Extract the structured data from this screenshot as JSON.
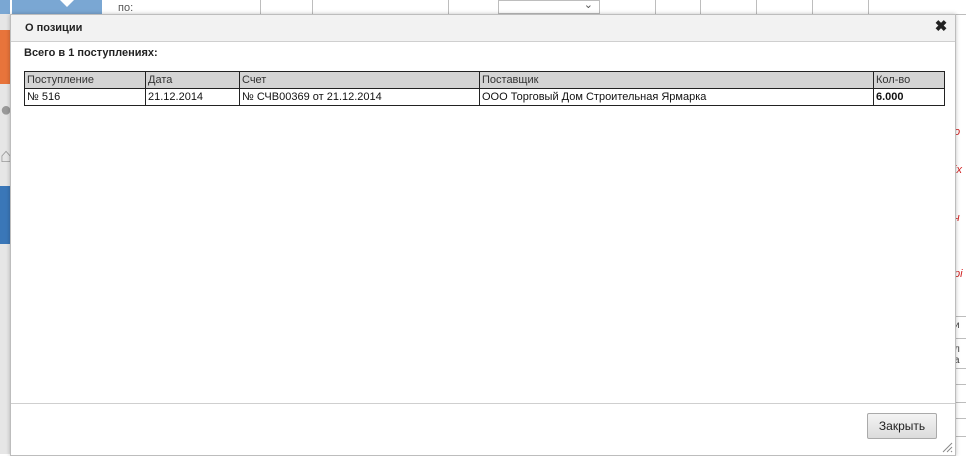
{
  "background": {
    "grid_header_text": "по:",
    "right_edge_red_fragments": [
      "о",
      "іх",
      "ч",
      "рі"
    ],
    "right_edge_gray_fragments": [
      "и",
      "л",
      "а"
    ]
  },
  "dialog": {
    "title": "О позиции",
    "summary": "Всего в 1 поступлениях:",
    "columns": [
      "Поступление",
      "Дата",
      "Счет",
      "Поставщик",
      "Кол-во"
    ],
    "rows": [
      {
        "receipt": "№ 516",
        "date": "21.12.2014",
        "invoice": "№ СЧВ00369 от 21.12.2014",
        "supplier": "ООО Торговый Дом Строительная Ярмарка",
        "quantity": "6.000"
      }
    ],
    "close_button_label": "Закрыть",
    "close_icon": "close-icon"
  },
  "colors": {
    "sidebar_orange": "#e8743b",
    "sidebar_blue": "#3a77b8",
    "header_row_bg": "#d4d4d4",
    "accent_red_text": "#d02020"
  }
}
